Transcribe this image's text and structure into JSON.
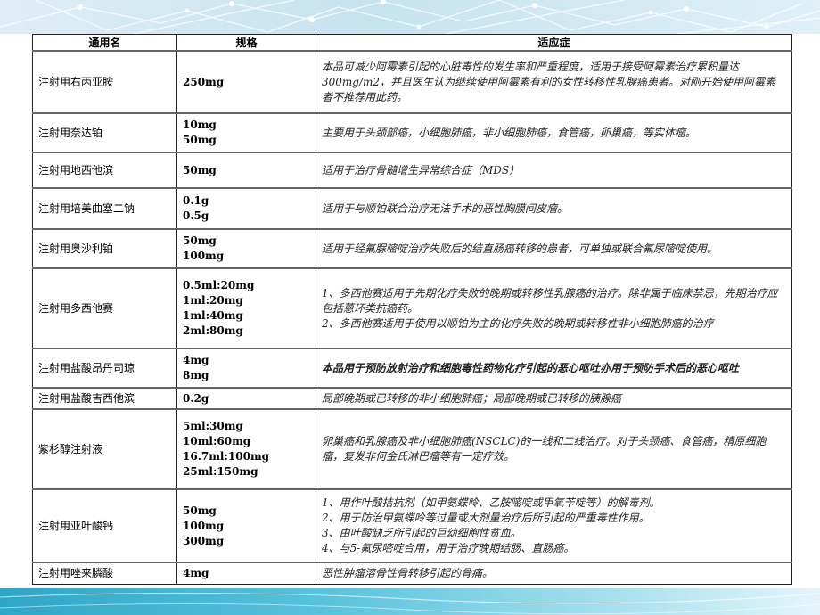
{
  "table": {
    "headers": [
      "通用名",
      "规格",
      "适应症"
    ],
    "rows": [
      {
        "name": "注射用右丙亚胺",
        "spec": [
          "250mg"
        ],
        "indication": [
          "本品可减少阿霉素引起的心脏毒性的发生率和严重程度，适用于接受阿霉素治疗累积量达300mg/m2，并且医生认为继续使用阿霉素有利的女性转移性乳腺癌患者。对刚开始使用阿霉素者不推荐用此药。"
        ],
        "bold": false
      },
      {
        "name": "注射用奈达铂",
        "spec": [
          "10mg",
          "50mg"
        ],
        "indication": [
          "主要用于头颈部癌，小细胞肺癌，非小细胞肺癌，食管癌，卵巢癌，等实体瘤。"
        ],
        "bold": false
      },
      {
        "name": "注射用地西他滨",
        "spec": [
          "50mg"
        ],
        "indication": [
          "适用于治疗骨髓增生异常综合症（MDS）"
        ],
        "bold": false
      },
      {
        "name": "注射用培美曲塞二钠",
        "spec": [
          "0.1g",
          "0.5g"
        ],
        "indication": [
          "适用于与顺铂联合治疗无法手术的恶性胸膜间皮瘤。"
        ],
        "bold": false
      },
      {
        "name": "注射用奥沙利铂",
        "spec": [
          "50mg",
          "100mg"
        ],
        "indication": [
          "适用于经氟脲嘧啶治疗失败后的结直肠癌转移的患者，可单独或联合氟尿嘧啶使用。"
        ],
        "bold": false
      },
      {
        "name": "注射用多西他赛",
        "spec": [
          "0.5ml:20mg",
          "1ml:20mg",
          "1ml:40mg",
          "2ml:80mg"
        ],
        "indication": [
          "1、多西他赛适用于先期化疗失败的晚期或转移性乳腺癌的治疗。除非属于临床禁忌，先期治疗应包括蒽环类抗癌药。",
          "2、多西他赛适用于使用以顺铂为主的化疗失败的晚期或转移性非小细胞肺癌的治疗"
        ],
        "bold": false
      },
      {
        "name": "注射用盐酸昂丹司琼",
        "spec": [
          "4mg",
          "8mg"
        ],
        "indication": [
          "本品用于预防放射治疗和细胞毒性药物化疗引起的恶心呕吐亦用于预防手术后的恶心呕吐"
        ],
        "bold": true
      },
      {
        "name": "注射用盐酸吉西他滨",
        "spec": [
          "0.2g"
        ],
        "indication": [
          "局部晚期或已转移的非小细胞肺癌；局部晚期或已转移的胰腺癌"
        ],
        "bold": false
      },
      {
        "name": "紫杉醇注射液",
        "spec": [
          "5ml:30mg",
          "10ml:60mg",
          "16.7ml:100mg",
          "25ml:150mg"
        ],
        "indication": [
          "卵巢癌和乳腺癌及非小细胞肺癌(NSCLC)的一线和二线治疗。对于头颈癌、食管癌，精原细胞瘤，复发非何金氏淋巴瘤等有一定疗效。"
        ],
        "bold": false
      },
      {
        "name": "注射用亚叶酸钙",
        "spec": [
          "50mg",
          "100mg",
          "300mg"
        ],
        "indication": [
          "1、用作叶酸拮抗剂（如甲氨蝶呤、乙胺嘧啶或甲氧苄啶等）的解毒剂。",
          "2、用于防治甲氨蝶呤等过量或大剂量治疗后所引起的严重毒性作用。",
          "3、由叶酸缺乏所引起的巨幼细胞性贫血。",
          "4、与5-氟尿嘧啶合用，用于治疗晚期结肠、直肠癌。"
        ],
        "bold": false
      },
      {
        "name": "注射用唑来膦酸",
        "spec": [
          "4mg"
        ],
        "indication": [
          "恶性肿瘤溶骨性骨转移引起的骨痛。"
        ],
        "bold": false
      }
    ]
  }
}
